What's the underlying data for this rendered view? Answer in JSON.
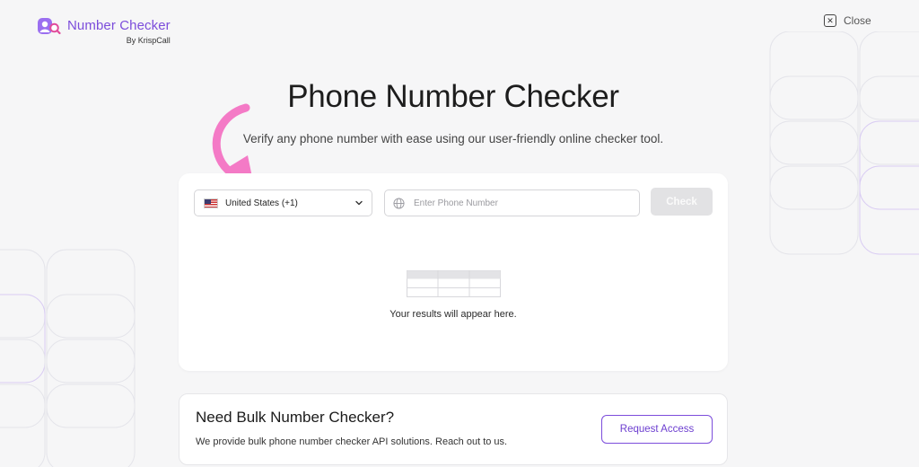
{
  "brand": {
    "title": "Number Checker",
    "subtitle": "By KrispCall",
    "accent_color": "#7c4ddb"
  },
  "header": {
    "close_label": "Close",
    "close_icon": "close-icon"
  },
  "hero": {
    "title": "Phone Number Checker",
    "subtitle": "Verify any phone number with ease using our user-friendly online checker tool."
  },
  "checker": {
    "country": {
      "selected": "United States (+1)",
      "flag_icon": "us-flag-icon"
    },
    "phone_input": {
      "placeholder": "Enter Phone Number",
      "value": "",
      "icon": "globe-icon"
    },
    "check_label": "Check",
    "results_placeholder": "Your results will appear here."
  },
  "bulk": {
    "title": "Need Bulk Number Checker?",
    "description": "We provide bulk phone number checker API solutions. Reach out to us.",
    "button_label": "Request Access"
  },
  "annotation": {
    "arrow_color": "#f47ac6"
  }
}
